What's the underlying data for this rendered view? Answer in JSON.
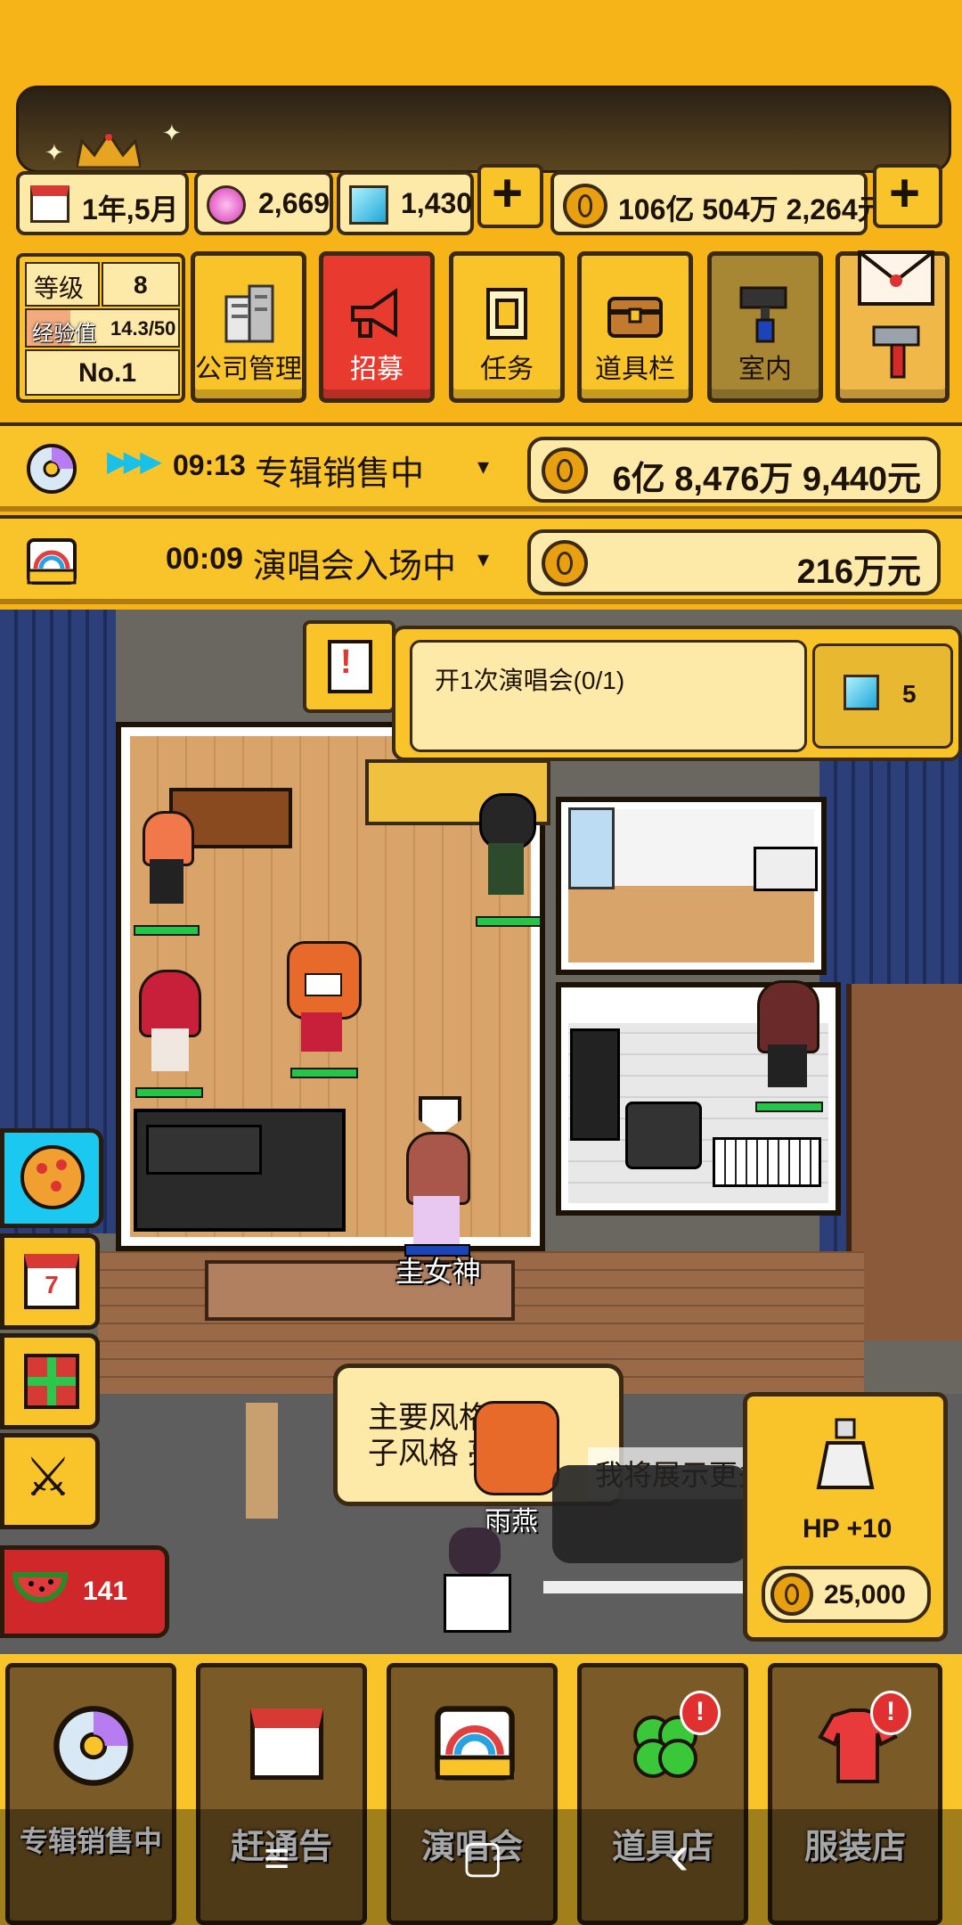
{
  "top": {
    "date": "1年,5月",
    "gems_pink": "2,669",
    "gems_blue": "1,430",
    "money": "106亿 504万 2,264元"
  },
  "player": {
    "level_label": "等级",
    "level_value": "8",
    "exp_label": "经验值",
    "exp_value": "14.3/50",
    "exp_fraction": 0.286,
    "rank": "No.1"
  },
  "menu": [
    {
      "label": "公司管理",
      "icon": "building-icon"
    },
    {
      "label": "招募",
      "icon": "megaphone-icon"
    },
    {
      "label": "任务",
      "icon": "scroll-icon"
    },
    {
      "label": "道具栏",
      "icon": "chest-icon"
    },
    {
      "label": "室内",
      "icon": "paint-roller-icon"
    }
  ],
  "status": [
    {
      "time": "09:13",
      "text": "专辑销售中",
      "amount": "6亿 8,476万 9,440元",
      "icon": "cd-icon"
    },
    {
      "time": "00:09",
      "text": "演唱会入场中",
      "amount": "216万元",
      "icon": "concert-icon"
    }
  ],
  "quest": {
    "text": "开1次演唱会(0/1)",
    "reward": "5"
  },
  "scene": {
    "character_name": "圭女神",
    "dialogue_left": "主要风格 感\n子风格 亮",
    "dialogue_right": "我将展示更多韵律。",
    "dialogue_speaker": "雨燕"
  },
  "side": {
    "watermelon_count": "141"
  },
  "shop": {
    "bonus": "HP +10",
    "price": "25,000"
  },
  "bottom_nav": [
    {
      "label": "专辑销售中",
      "icon": "cd-icon"
    },
    {
      "label": "赶通告",
      "icon": "calendar-icon"
    },
    {
      "label": "演唱会",
      "icon": "concert-icon"
    },
    {
      "label": "道具店",
      "icon": "clover-icon"
    },
    {
      "label": "服装店",
      "icon": "shirt-icon"
    }
  ],
  "system_nav": {
    "menu_glyph": "≡",
    "home_glyph": "▢",
    "back_glyph": "‹"
  }
}
